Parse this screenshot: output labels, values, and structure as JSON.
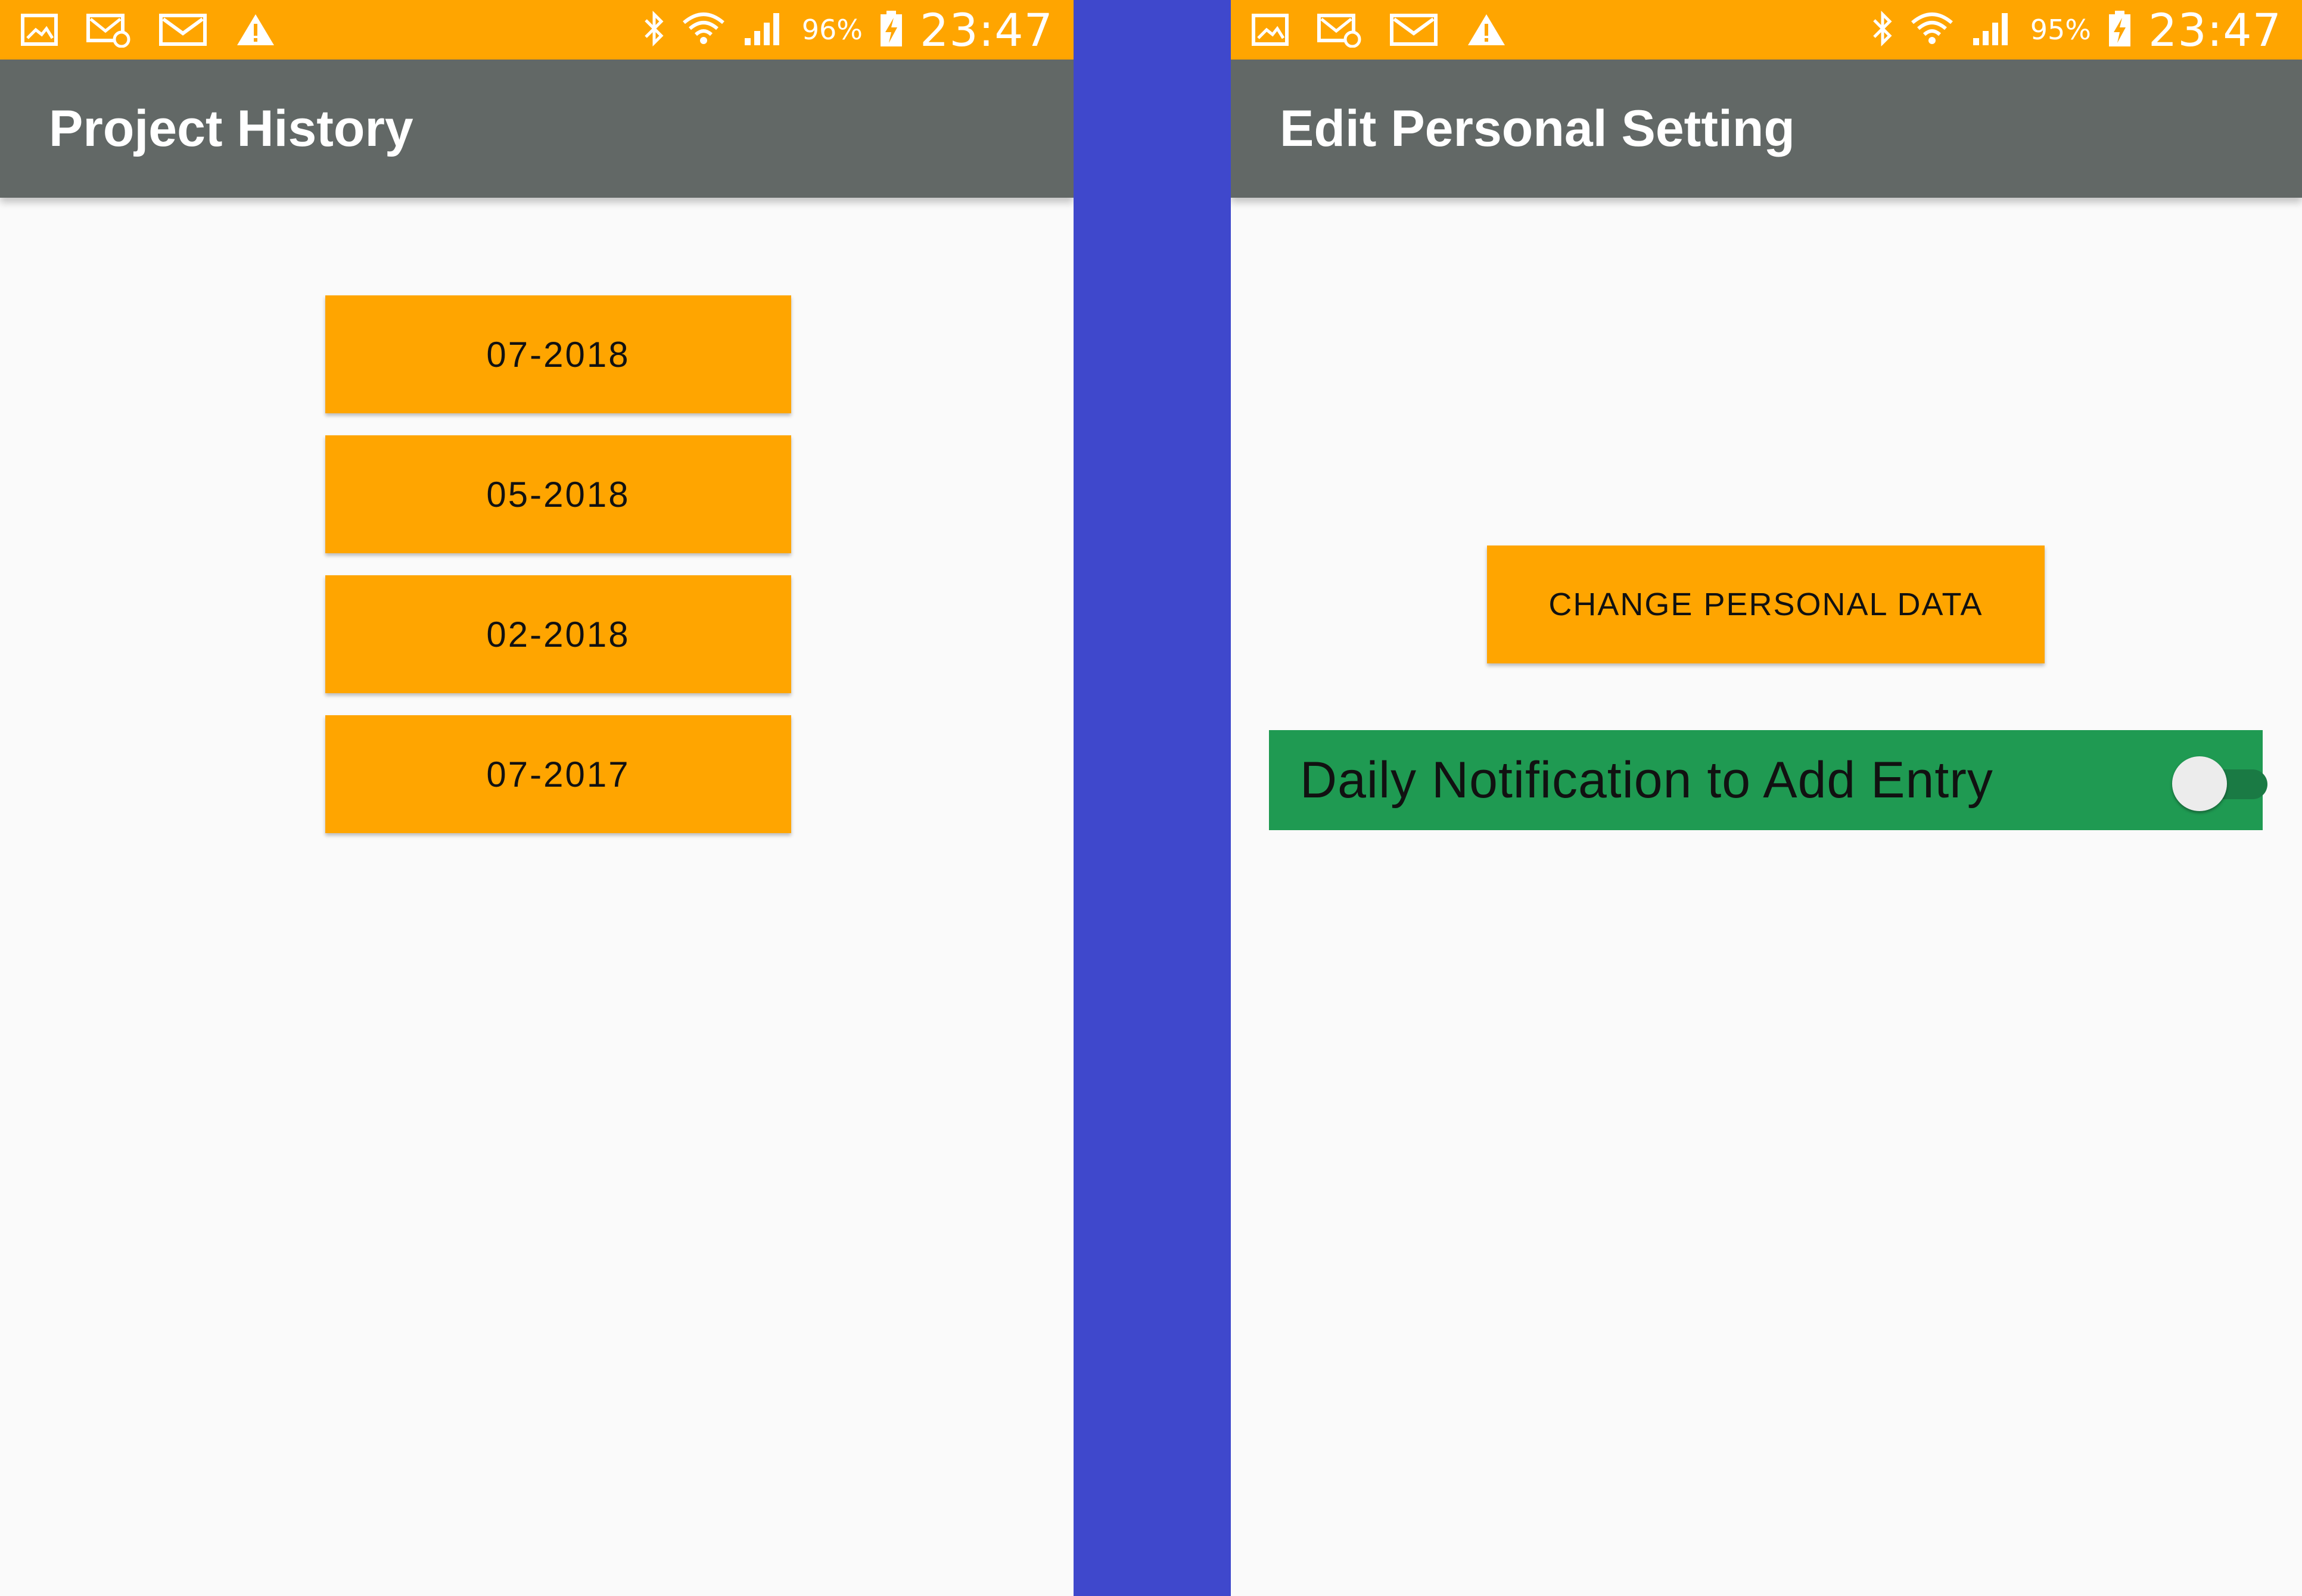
{
  "colors": {
    "divider": "#3f48cc",
    "status_bar": "#ffa500",
    "app_bar": "#626866",
    "button": "#ffa500",
    "notification_row": "#1f9a52",
    "background": "#fafafa"
  },
  "left_screen": {
    "status_bar": {
      "icons": [
        "gallery-icon",
        "mms-icon",
        "email-icon",
        "warning-icon",
        "bluetooth-icon",
        "wifi-icon",
        "signal-icon",
        "battery-charging-icon"
      ],
      "battery": "96%",
      "time": "23:47"
    },
    "title": "Project History",
    "history_items": [
      {
        "label": "07-2018"
      },
      {
        "label": "05-2018"
      },
      {
        "label": "02-2018"
      },
      {
        "label": "07-2017"
      }
    ]
  },
  "right_screen": {
    "status_bar": {
      "icons": [
        "gallery-icon",
        "mms-icon",
        "email-icon",
        "warning-icon",
        "bluetooth-icon",
        "wifi-icon",
        "signal-icon",
        "battery-charging-icon"
      ],
      "battery": "95%",
      "time": "23:47"
    },
    "title": "Edit Personal Setting",
    "change_button": "CHANGE PERSONAL DATA",
    "notification": {
      "label": "Daily Notification to Add Entry",
      "enabled": false
    }
  }
}
